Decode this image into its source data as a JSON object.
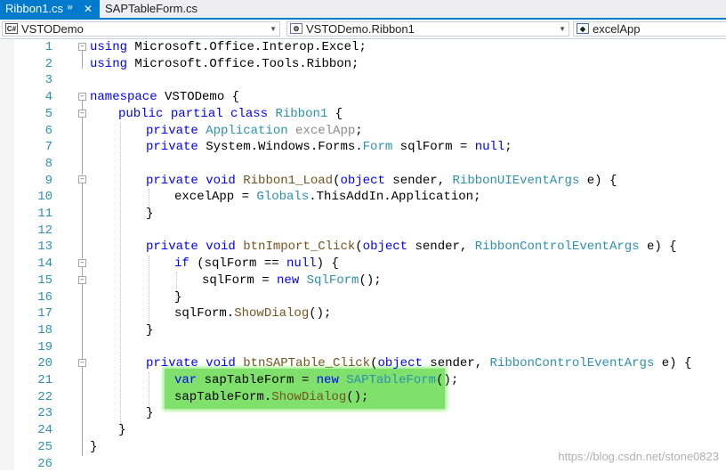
{
  "tabs": [
    {
      "label": "Ribbon1.cs",
      "active": true,
      "pin_icon": "pin-icon",
      "close_icon": "close-icon"
    },
    {
      "label": "SAPTableForm.cs",
      "active": false
    }
  ],
  "navbar": {
    "project": "VSTODemo",
    "project_icon": "csharp-project-icon",
    "class": "VSTODemo.Ribbon1",
    "class_icon": "class-icon",
    "member": "excelApp",
    "member_icon": "field-icon"
  },
  "line_numbers": [
    "1",
    "2",
    "3",
    "4",
    "5",
    "6",
    "7",
    "8",
    "9",
    "10",
    "11",
    "12",
    "13",
    "14",
    "15",
    "16",
    "17",
    "18",
    "19",
    "20",
    "21",
    "22",
    "23",
    "24",
    "25",
    "26"
  ],
  "code": {
    "l1": [
      "using",
      " Microsoft.Office.Interop.Excel;"
    ],
    "l2": [
      "using",
      " Microsoft.Office.Tools.Ribbon;"
    ],
    "l4": [
      "namespace",
      " VSTODemo {"
    ],
    "l5": [
      "public",
      " ",
      "partial",
      " ",
      "class",
      " ",
      "Ribbon1",
      " {"
    ],
    "l6": [
      "private",
      " ",
      "Application",
      " ",
      "excelApp",
      ";"
    ],
    "l7": [
      "private",
      " System.Windows.Forms.",
      "Form",
      " sqlForm = ",
      "null",
      ";"
    ],
    "l9": [
      "private",
      " ",
      "void",
      " ",
      "Ribbon1_Load",
      "(",
      "object",
      " sender, ",
      "RibbonUIEventArgs",
      " e) {"
    ],
    "l10": [
      "excelApp = ",
      "Globals",
      ".ThisAddIn.Application;"
    ],
    "l11": [
      "}"
    ],
    "l13": [
      "private",
      " ",
      "void",
      " ",
      "btnImport_Click",
      "(",
      "object",
      " sender, ",
      "RibbonControlEventArgs",
      " e) {"
    ],
    "l14": [
      "if",
      " (sqlForm == ",
      "null",
      ") {"
    ],
    "l15": [
      "sqlForm = ",
      "new",
      " ",
      "SqlForm",
      "();"
    ],
    "l16": [
      "}"
    ],
    "l17": [
      "sqlForm.",
      "ShowDialog",
      "();"
    ],
    "l18": [
      "}"
    ],
    "l20": [
      "private",
      " ",
      "void",
      " ",
      "btnSAPTable_Click",
      "(",
      "object",
      " sender, ",
      "RibbonControlEventArgs",
      " e) {"
    ],
    "l21": [
      "var",
      " sapTableForm = ",
      "new",
      " ",
      "SAPTableForm",
      "();"
    ],
    "l22": [
      "sapTableForm.",
      "ShowDialog",
      "();"
    ],
    "l23": [
      "}"
    ],
    "l24": [
      "}"
    ],
    "l25": [
      "}"
    ]
  },
  "colors": {
    "keyword": "#0000ff",
    "type": "#2b91af",
    "method": "#74531f",
    "highlight": "#7fe06b",
    "tab_active": "#007acc"
  },
  "watermark": "https://blog.csdn.net/stone0823"
}
